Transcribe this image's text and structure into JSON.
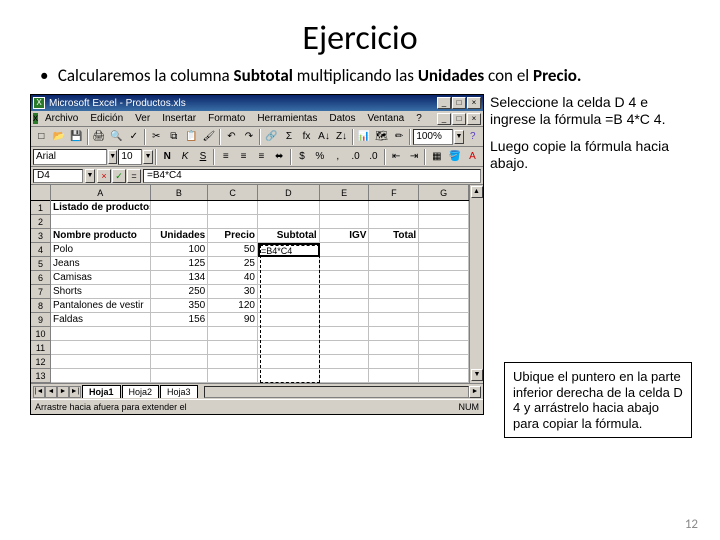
{
  "slide": {
    "title": "Ejercicio",
    "instruction_pre": "Calcularemos la columna ",
    "instruction_b1": "Subtotal",
    "instruction_mid": " multiplicando las ",
    "instruction_b2": "Unidades",
    "instruction_mid2": " con el ",
    "instruction_b3": "Precio.",
    "bullet": "•",
    "page_num": "12"
  },
  "excel": {
    "window_title": "Microsoft Excel - Productos.xls",
    "menu": [
      "Archivo",
      "Edición",
      "Ver",
      "Insertar",
      "Formato",
      "Herramientas",
      "Datos",
      "Ventana",
      "?"
    ],
    "toolbar1": {
      "zoom": "100%"
    },
    "toolbar2": {
      "font": "Arial",
      "size": "10",
      "bold": "N",
      "italic": "K",
      "underline": "S"
    },
    "formula": {
      "namebox": "D4",
      "value": "=B4*C4",
      "eq": "="
    },
    "columns": [
      "A",
      "B",
      "C",
      "D",
      "E",
      "F",
      "G"
    ],
    "row_numbers": [
      "1",
      "2",
      "3",
      "4",
      "5",
      "6",
      "7",
      "8",
      "9",
      "10",
      "11",
      "12",
      "13"
    ],
    "rows": [
      {
        "A": "Listado de productos",
        "B": "",
        "C": "",
        "D": "",
        "E": "",
        "F": "",
        "G": ""
      },
      {
        "A": "",
        "B": "",
        "C": "",
        "D": "",
        "E": "",
        "F": "",
        "G": ""
      },
      {
        "A": "Nombre producto",
        "B": "Unidades",
        "C": "Precio",
        "D": "Subtotal",
        "E": "IGV",
        "F": "Total",
        "G": ""
      },
      {
        "A": "Polo",
        "B": "100",
        "C": "50",
        "D": "=B4*C4",
        "E": "",
        "F": "",
        "G": ""
      },
      {
        "A": "Jeans",
        "B": "125",
        "C": "25",
        "D": "",
        "E": "",
        "F": "",
        "G": ""
      },
      {
        "A": "Camisas",
        "B": "134",
        "C": "40",
        "D": "",
        "E": "",
        "F": "",
        "G": ""
      },
      {
        "A": "Shorts",
        "B": "250",
        "C": "30",
        "D": "",
        "E": "",
        "F": "",
        "G": ""
      },
      {
        "A": "Pantalones de vestir",
        "B": "350",
        "C": "120",
        "D": "",
        "E": "",
        "F": "",
        "G": ""
      },
      {
        "A": "Faldas",
        "B": "156",
        "C": "90",
        "D": "",
        "E": "",
        "F": "",
        "G": ""
      },
      {
        "A": "",
        "B": "",
        "C": "",
        "D": "",
        "E": "",
        "F": "",
        "G": ""
      },
      {
        "A": "",
        "B": "",
        "C": "",
        "D": "",
        "E": "",
        "F": "",
        "G": ""
      },
      {
        "A": "",
        "B": "",
        "C": "",
        "D": "",
        "E": "",
        "F": "",
        "G": ""
      },
      {
        "A": "",
        "B": "",
        "C": "",
        "D": "",
        "E": "",
        "F": "",
        "G": ""
      }
    ],
    "tabs": [
      "Hoja1",
      "Hoja2",
      "Hoja3"
    ],
    "status_left": "Arrastre hacia afuera para extender el",
    "status_right": "NUM"
  },
  "notes": {
    "n1_a": "Seleccione la celda D 4 e ingrese la fórmula =B 4*C 4.",
    "n2": "Luego copie la fórmula hacia abajo.",
    "callout": "Ubique el puntero en la parte inferior derecha de la celda D 4 y arrástrelo hacia abajo para copiar la fórmula."
  },
  "win_btns": {
    "min": "_",
    "max": "□",
    "close": "×"
  },
  "scroll": {
    "up": "▲",
    "down": "▼",
    "left": "◄",
    "right": "►"
  },
  "tab_nav": {
    "first": "|◄",
    "prev": "◄",
    "next": "►",
    "last": "►|"
  }
}
